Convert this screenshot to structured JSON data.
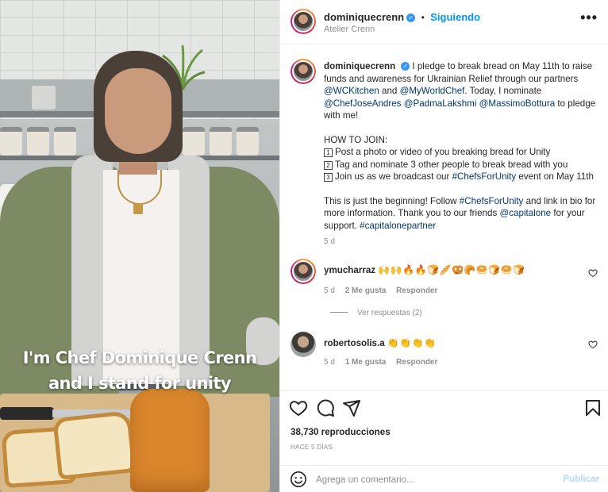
{
  "video": {
    "overlay_line1": "I'm Chef Dominique Crenn",
    "overlay_line2": "and I stand for unity"
  },
  "header": {
    "username": "dominiquecrenn",
    "separator": "•",
    "follow_label": "Siguiendo",
    "location": "Atelier Crenn",
    "more_icon": "•••"
  },
  "caption": {
    "username": "dominiquecrenn",
    "p1_text1": "I pledge to break bread on May 11th to raise funds and awareness for Ukrainian Relief through our partners",
    "p1_link1": "@WCKitchen",
    "p1_and": "and",
    "p1_link2": "@MyWorldChef",
    "p1_text2": ". Today, I nominate",
    "p1_link3": "@ChefJoseAndres",
    "p1_link4": "@PadmaLakshmi",
    "p1_link5": "@MassimoBottura",
    "p1_text3": "to pledge with me!",
    "how_title": "HOW TO JOIN:",
    "step1_num": "1",
    "step1": "Post a photo or video of you breaking bread for Unity",
    "step2_num": "2",
    "step2": "Tag and nominate 3 other people to break bread with you",
    "step3_num": "3",
    "step3_text": "Join us as we broadcast our",
    "step3_link": "#ChefsForUnity",
    "step3_end": "event on May 11th",
    "p3_text1": "This is just the beginning! Follow",
    "p3_link1": "#ChefsForUnity",
    "p3_text2": "and link in bio for more information. Thank you to our friends",
    "p3_link2": "@capitalone",
    "p3_text3": "for your support.",
    "p3_link3": "#capitalonepartner",
    "time": "5 d"
  },
  "comments": [
    {
      "username": "ymucharraz",
      "text": "🙌🙌🔥🔥🍞🥖🥨🥐🥯🍞🥯🍞",
      "time": "5 d",
      "likes": "2 Me gusta",
      "reply": "Responder"
    },
    {
      "username": "robertosolis.a",
      "text": "👏👏👏👏",
      "time": "5 d",
      "likes": "1 Me gusta",
      "reply": "Responder"
    }
  ],
  "view_replies": "Ver respuestas (2)",
  "actions": {
    "views": "38,730 reproducciones",
    "ago": "HACE 5 DÍAS"
  },
  "add_comment": {
    "placeholder": "Agrega un comentario...",
    "publish": "Publicar"
  },
  "colors": {
    "link": "#00376b",
    "accent": "#0095f6",
    "publish_disabled": "#b3dbff",
    "secondary_text": "#8e8e8e"
  }
}
